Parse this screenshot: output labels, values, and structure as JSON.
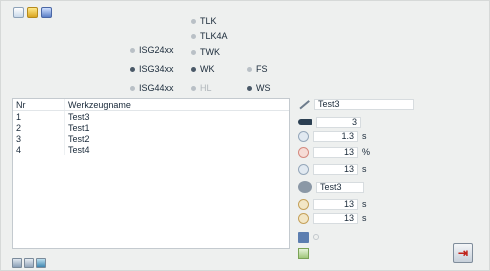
{
  "toolbar": {
    "buttons": [
      {
        "name": "new-document-button",
        "icon": "document-icon"
      },
      {
        "name": "open-folder-button",
        "icon": "folder-icon"
      },
      {
        "name": "save-button",
        "icon": "disk-icon"
      }
    ]
  },
  "options": {
    "col1": [
      {
        "label": "ISG24xx",
        "selected": false
      },
      {
        "label": "ISG34xx",
        "selected": true
      },
      {
        "label": "ISG44xx",
        "selected": false
      }
    ],
    "col2": [
      {
        "label": "TLK",
        "selected": false
      },
      {
        "label": "TLK4A",
        "selected": false
      },
      {
        "label": "TWK",
        "selected": false
      },
      {
        "label": "WK",
        "selected": true
      },
      {
        "label": "HL",
        "selected": false,
        "disabled": true
      }
    ],
    "col3": [
      {
        "label": "FS",
        "selected": false
      },
      {
        "label": "WS",
        "selected": true
      }
    ]
  },
  "table": {
    "headers": [
      "Nr",
      "Werkzeugname"
    ],
    "rows": [
      [
        "1",
        "Test3"
      ],
      [
        "2",
        "Test1"
      ],
      [
        "3",
        "Test2"
      ],
      [
        "4",
        "Test4"
      ]
    ]
  },
  "properties": {
    "name_value": "Test3",
    "p1_value": "3",
    "p2_value": "1.3",
    "p2_unit": "s",
    "p3_value": "13",
    "p3_unit": "%",
    "p4_value": "13",
    "p4_unit": "s",
    "tool_value": "Test3",
    "p5_value": "13",
    "p5_unit": "s",
    "p6_value": "13",
    "p6_unit": "s"
  },
  "bottom_buttons": [
    "add-icon",
    "edit-icon",
    "delete-icon"
  ],
  "colors": {
    "exit_accent": "#c0221a"
  }
}
